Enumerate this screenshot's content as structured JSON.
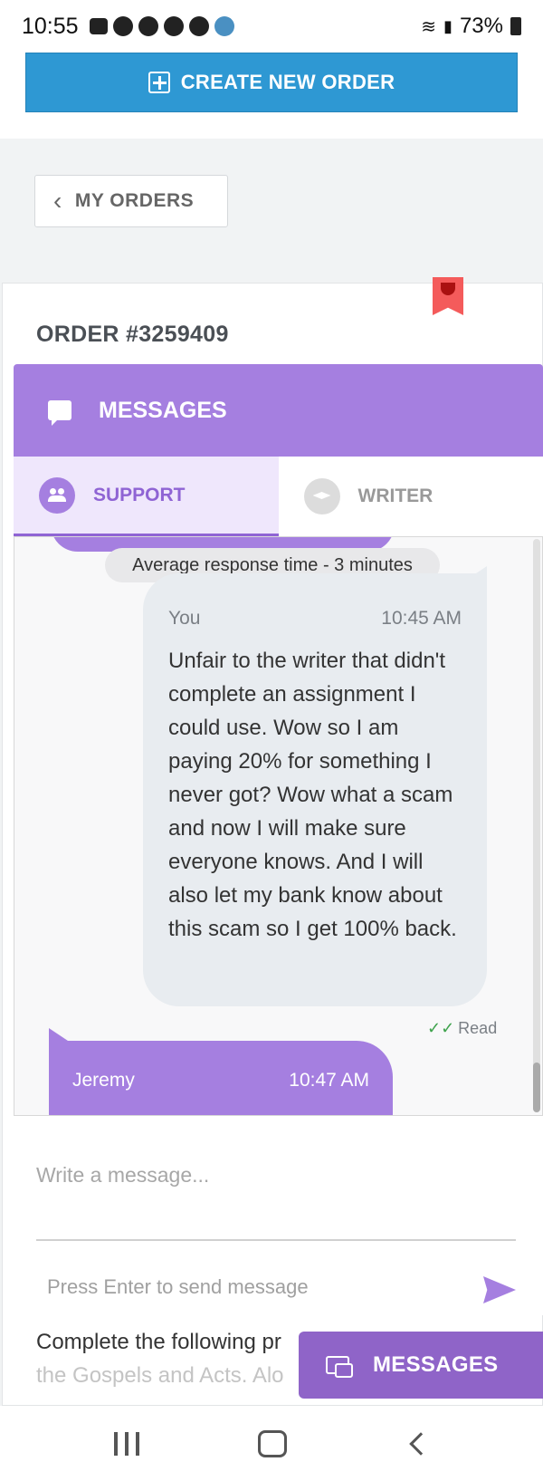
{
  "status_bar": {
    "time": "10:55",
    "battery": "73%"
  },
  "toolbar": {
    "create_order_label": "CREATE NEW ORDER"
  },
  "nav": {
    "my_orders_label": "MY ORDERS"
  },
  "order": {
    "title": "ORDER #3259409"
  },
  "messages_panel": {
    "header": "MESSAGES",
    "tabs": [
      {
        "label": "SUPPORT",
        "active": true,
        "icon": "people-icon"
      },
      {
        "label": "WRITER",
        "active": false,
        "icon": "graduation-cap-icon"
      }
    ],
    "avg_response": "Average response time - 3 minutes",
    "messages": [
      {
        "sender": "You",
        "time": "10:45 AM",
        "text": "Unfair to the writer that didn't complete an assignment I could use. Wow so I am paying 20% for something I never got? Wow what a scam and now I will make sure everyone knows. And I will also let my bank know about this scam so I get 100% back.",
        "status": "Read"
      },
      {
        "sender": "Jeremy",
        "time": "10:47 AM"
      }
    ],
    "input_placeholder": "Write a message...",
    "enter_hint": "Press Enter to send message"
  },
  "description": {
    "line1": "Complete the following pr",
    "line2": "the Gospels and Acts. Alo"
  },
  "floating_button": {
    "label": "MESSAGES"
  },
  "colors": {
    "primary_blue": "#2e98d3",
    "purple": "#a57fe0",
    "purple_dark": "#8f64c8",
    "ribbon_red": "#f45b5b"
  }
}
